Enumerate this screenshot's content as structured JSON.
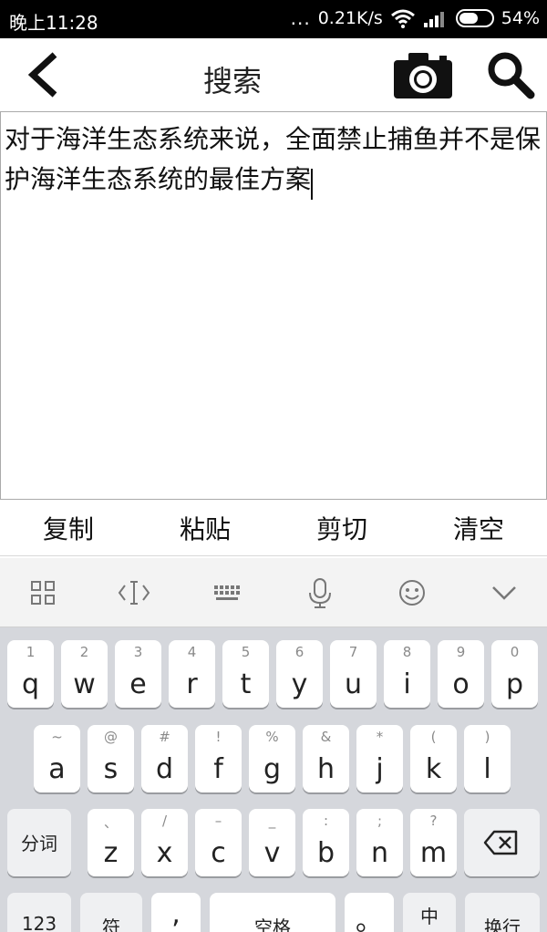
{
  "status_bar": {
    "time": "晚上11:28",
    "dots": "...",
    "speed": "0.21K/s",
    "battery": "54%",
    "battery_level": 0.54,
    "icons": [
      "wifi-icon",
      "signal-icon",
      "battery-icon"
    ]
  },
  "header": {
    "title": "搜索",
    "icons": [
      "back-arrow-icon",
      "camera-icon",
      "search-icon"
    ]
  },
  "text_area": {
    "content": "对于海洋生态系统来说，全面禁止捕鱼并不是保护海洋生态系统的最佳方案"
  },
  "actions": {
    "copy": "复制",
    "paste": "粘贴",
    "cut": "剪切",
    "clear": "清空"
  },
  "keyboard_toolbar": {
    "icons": [
      "grid-icon",
      "cursor-icon",
      "keyboard-icon",
      "microphone-icon",
      "emoji-icon",
      "chevron-down-icon"
    ]
  },
  "keyboard": {
    "row1": [
      {
        "sub": "1",
        "main": "q"
      },
      {
        "sub": "2",
        "main": "w"
      },
      {
        "sub": "3",
        "main": "e"
      },
      {
        "sub": "4",
        "main": "r"
      },
      {
        "sub": "5",
        "main": "t"
      },
      {
        "sub": "6",
        "main": "y"
      },
      {
        "sub": "7",
        "main": "u"
      },
      {
        "sub": "8",
        "main": "i"
      },
      {
        "sub": "9",
        "main": "o"
      },
      {
        "sub": "0",
        "main": "p"
      }
    ],
    "row2": [
      {
        "sub": "~",
        "main": "a"
      },
      {
        "sub": "@",
        "main": "s"
      },
      {
        "sub": "#",
        "main": "d"
      },
      {
        "sub": "!",
        "main": "f"
      },
      {
        "sub": "%",
        "main": "g"
      },
      {
        "sub": "&",
        "main": "h"
      },
      {
        "sub": "*",
        "main": "j"
      },
      {
        "sub": "(",
        "main": "k"
      },
      {
        "sub": ")",
        "main": "l"
      }
    ],
    "row3": [
      {
        "sub": "、",
        "main": "z"
      },
      {
        "sub": "/",
        "main": "x"
      },
      {
        "sub": "–",
        "main": "c"
      },
      {
        "sub": "_",
        "main": "v"
      },
      {
        "sub": ":",
        "main": "b"
      },
      {
        "sub": ";",
        "main": "n"
      },
      {
        "sub": "?",
        "main": "m"
      }
    ],
    "fenci": "分词",
    "row4": {
      "num": "123",
      "sym": "符",
      "comma": ",",
      "space": "空格",
      "period": "。",
      "lang": "中",
      "enter": "换行"
    }
  }
}
